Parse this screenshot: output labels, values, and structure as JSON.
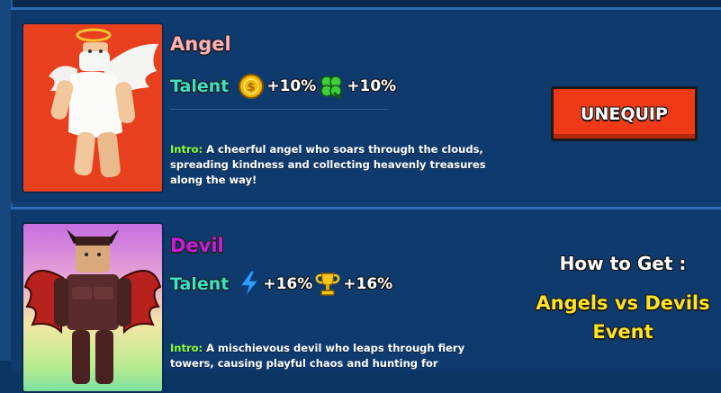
{
  "cards": [
    {
      "name": "Angel",
      "talent_label": "Talent",
      "stats": [
        {
          "icon": "coin-icon",
          "value": "+10%"
        },
        {
          "icon": "clover-icon",
          "value": "+10%"
        }
      ],
      "intro_label": "Intro:",
      "intro_text": "A cheerful angel who soars through the clouds, spreading kindness and collecting heavenly treasures along the way!",
      "button_label": "UNEQUIP"
    },
    {
      "name": "Devil",
      "talent_label": "Talent",
      "stats": [
        {
          "icon": "lightning-icon",
          "value": "+16%"
        },
        {
          "icon": "trophy-icon",
          "value": "+16%"
        }
      ],
      "intro_label": "Intro:",
      "intro_text": "A mischievous devil who leaps through fiery towers, causing playful chaos and hunting for",
      "how_to_get_label": "How to Get :",
      "event_line1": "Angels vs Devils",
      "event_line2": "Event"
    }
  ],
  "colors": {
    "background": "#0f3e73",
    "angel_name": "#ffb2b8",
    "devil_name": "#c21fd6",
    "talent": "#3fe0c6",
    "intro_label": "#8dff3a",
    "button": "#ef3a18",
    "event": "#ffe229"
  }
}
